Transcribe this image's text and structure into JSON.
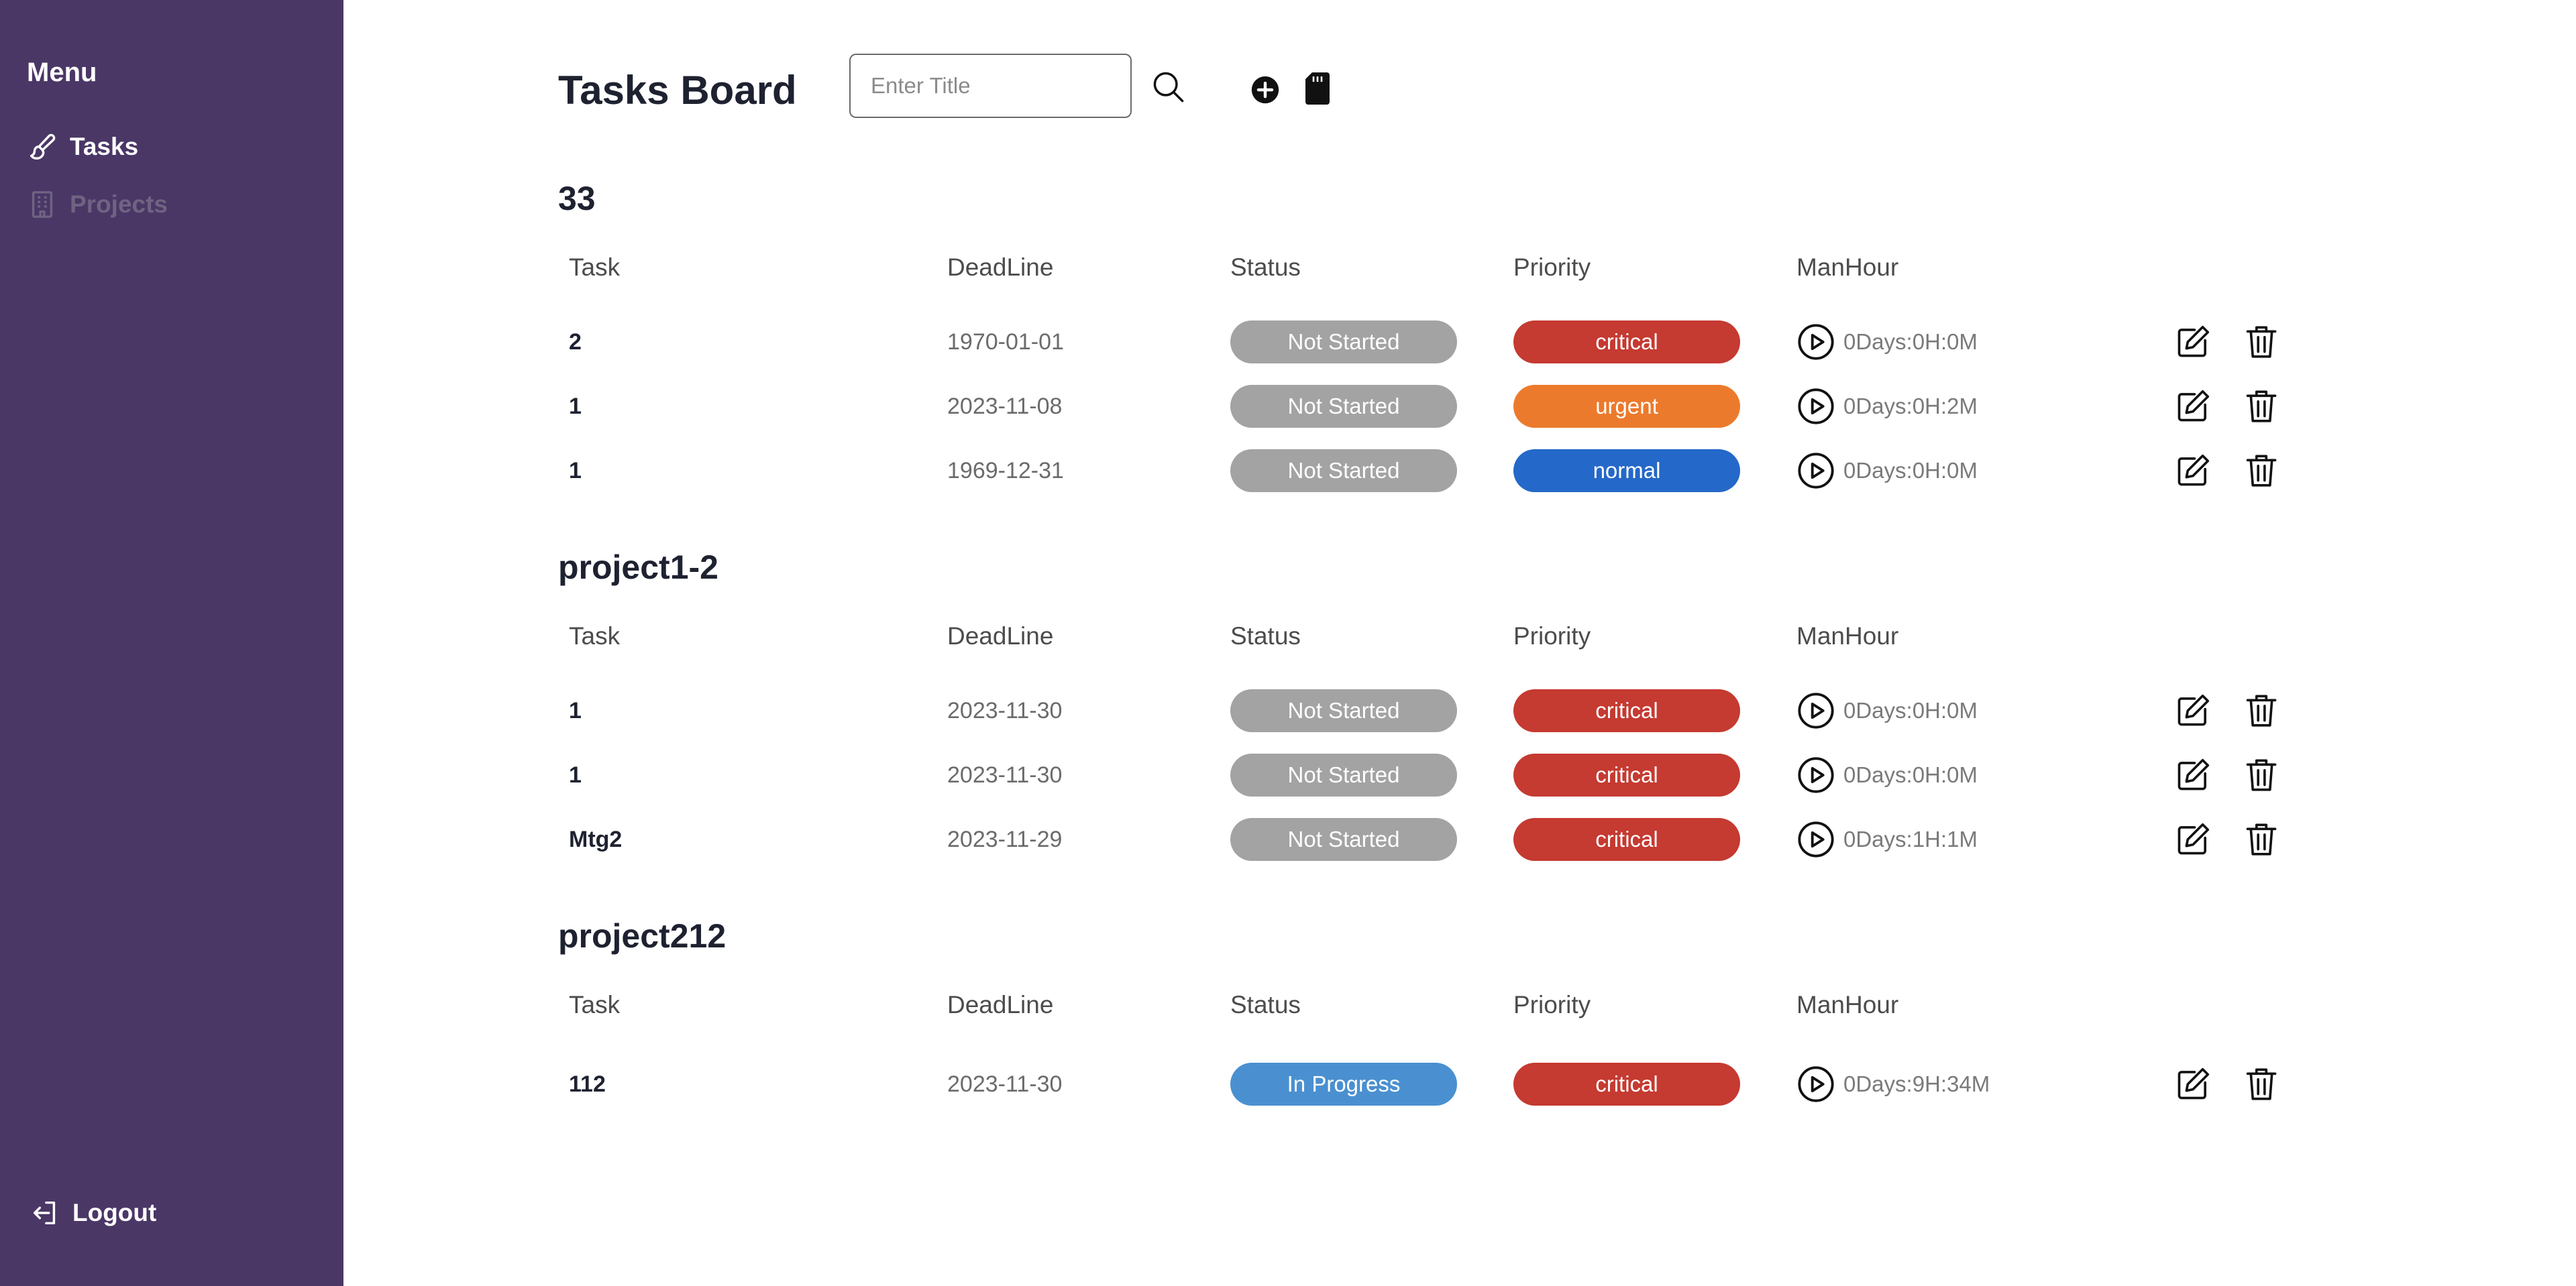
{
  "sidebar": {
    "menu_title": "Menu",
    "items": [
      {
        "label": "Tasks",
        "icon": "brush-icon",
        "active": true
      },
      {
        "label": "Projects",
        "icon": "building-icon",
        "active": false
      }
    ],
    "logout_label": "Logout"
  },
  "header": {
    "title": "Tasks Board",
    "search_placeholder": "Enter Title",
    "icons": [
      "search-icon",
      "plus-circle-icon",
      "sd-card-icon"
    ]
  },
  "columns": {
    "task": "Task",
    "deadline": "DeadLine",
    "status": "Status",
    "priority": "Priority",
    "manhour": "ManHour"
  },
  "colors": {
    "sidebar_bg": "#4a3766",
    "status_not_started": "#a3a3a3",
    "status_in_progress": "#4a90d0",
    "priority_critical": "#c53a31",
    "priority_urgent": "#ec7a2c",
    "priority_normal": "#2468c9"
  },
  "projects": [
    {
      "name": "33",
      "tasks": [
        {
          "task": "2",
          "deadline": "1970-01-01",
          "status": "Not Started",
          "priority": "critical",
          "manhour": "0Days:0H:0M"
        },
        {
          "task": "1",
          "deadline": "2023-11-08",
          "status": "Not Started",
          "priority": "urgent",
          "manhour": "0Days:0H:2M"
        },
        {
          "task": "1",
          "deadline": "1969-12-31",
          "status": "Not Started",
          "priority": "normal",
          "manhour": "0Days:0H:0M"
        }
      ]
    },
    {
      "name": "project1-2",
      "tasks": [
        {
          "task": "1",
          "deadline": "2023-11-30",
          "status": "Not Started",
          "priority": "critical",
          "manhour": "0Days:0H:0M"
        },
        {
          "task": "1",
          "deadline": "2023-11-30",
          "status": "Not Started",
          "priority": "critical",
          "manhour": "0Days:0H:0M"
        },
        {
          "task": "Mtg2",
          "deadline": "2023-11-29",
          "status": "Not Started",
          "priority": "critical",
          "manhour": "0Days:1H:1M"
        }
      ]
    },
    {
      "name": "project212",
      "tasks": [
        {
          "task": "112",
          "deadline": "2023-11-30",
          "status": "In Progress",
          "priority": "critical",
          "manhour": "0Days:9H:34M"
        }
      ]
    }
  ]
}
